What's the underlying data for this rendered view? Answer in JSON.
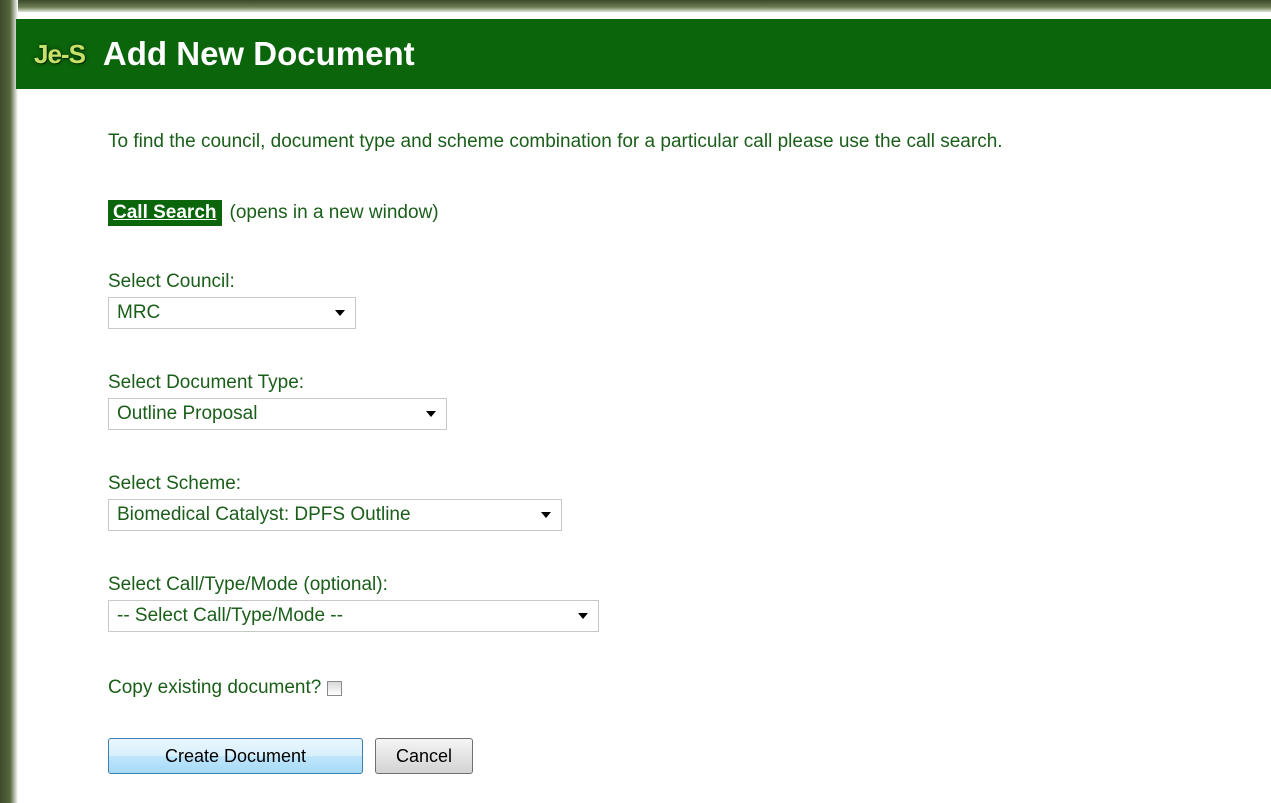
{
  "header": {
    "logo": "Je-S",
    "title": "Add New Document"
  },
  "intro_text": "To find the council, document type and scheme combination for a particular call please use the call search.",
  "call_search": {
    "link_label": "Call Search",
    "note": "(opens in a new window)"
  },
  "fields": {
    "council": {
      "label": "Select Council:",
      "value": "MRC"
    },
    "document_type": {
      "label": "Select Document Type:",
      "value": "Outline Proposal"
    },
    "scheme": {
      "label": "Select Scheme:",
      "value": "Biomedical Catalyst: DPFS Outline"
    },
    "call": {
      "label": "Select Call/Type/Mode (optional):",
      "value": "-- Select Call/Type/Mode --"
    }
  },
  "copy_existing": {
    "label": "Copy existing document?",
    "checked": false
  },
  "buttons": {
    "create": "Create Document",
    "cancel": "Cancel"
  },
  "colors": {
    "header_bg": "#0b650b",
    "text_green": "#1a5e1a",
    "logo": "#c6e06a"
  }
}
